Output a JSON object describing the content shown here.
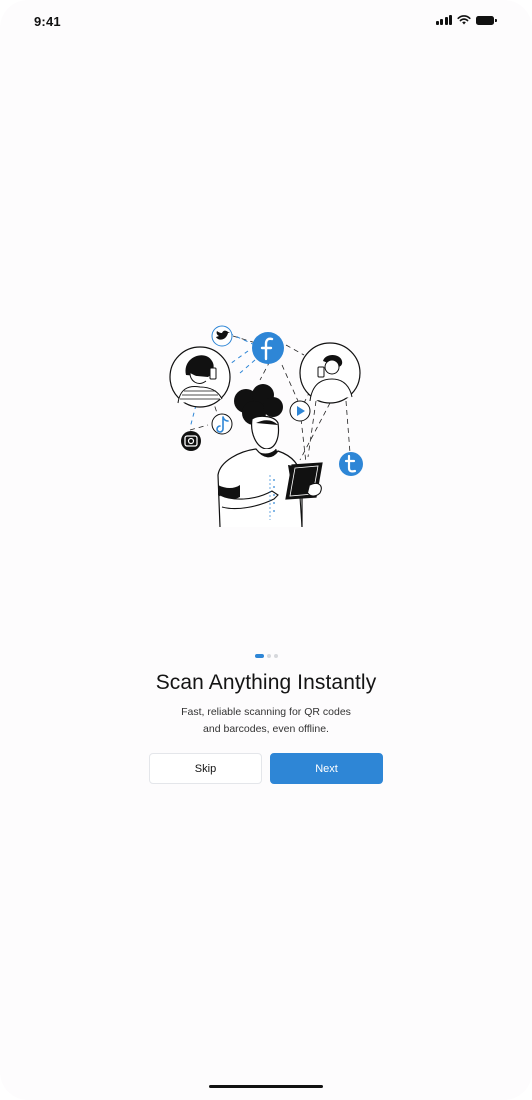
{
  "status_bar": {
    "time": "9:41"
  },
  "onboarding": {
    "title": "Scan Anything Instantly",
    "subtitle_line1": "Fast, reliable scanning for QR codes",
    "subtitle_line2": "and barcodes, even offline.",
    "page_count": 3,
    "active_page": 1,
    "skip_label": "Skip",
    "next_label": "Next"
  },
  "icons": {
    "illustration_icons": [
      "twitter-icon",
      "facebook-icon",
      "play-icon",
      "tiktok-icon",
      "instagram-icon",
      "tumblr-icon"
    ]
  },
  "colors": {
    "accent": "#2e86d6",
    "background": "#fdfcfd",
    "text": "#141414"
  }
}
